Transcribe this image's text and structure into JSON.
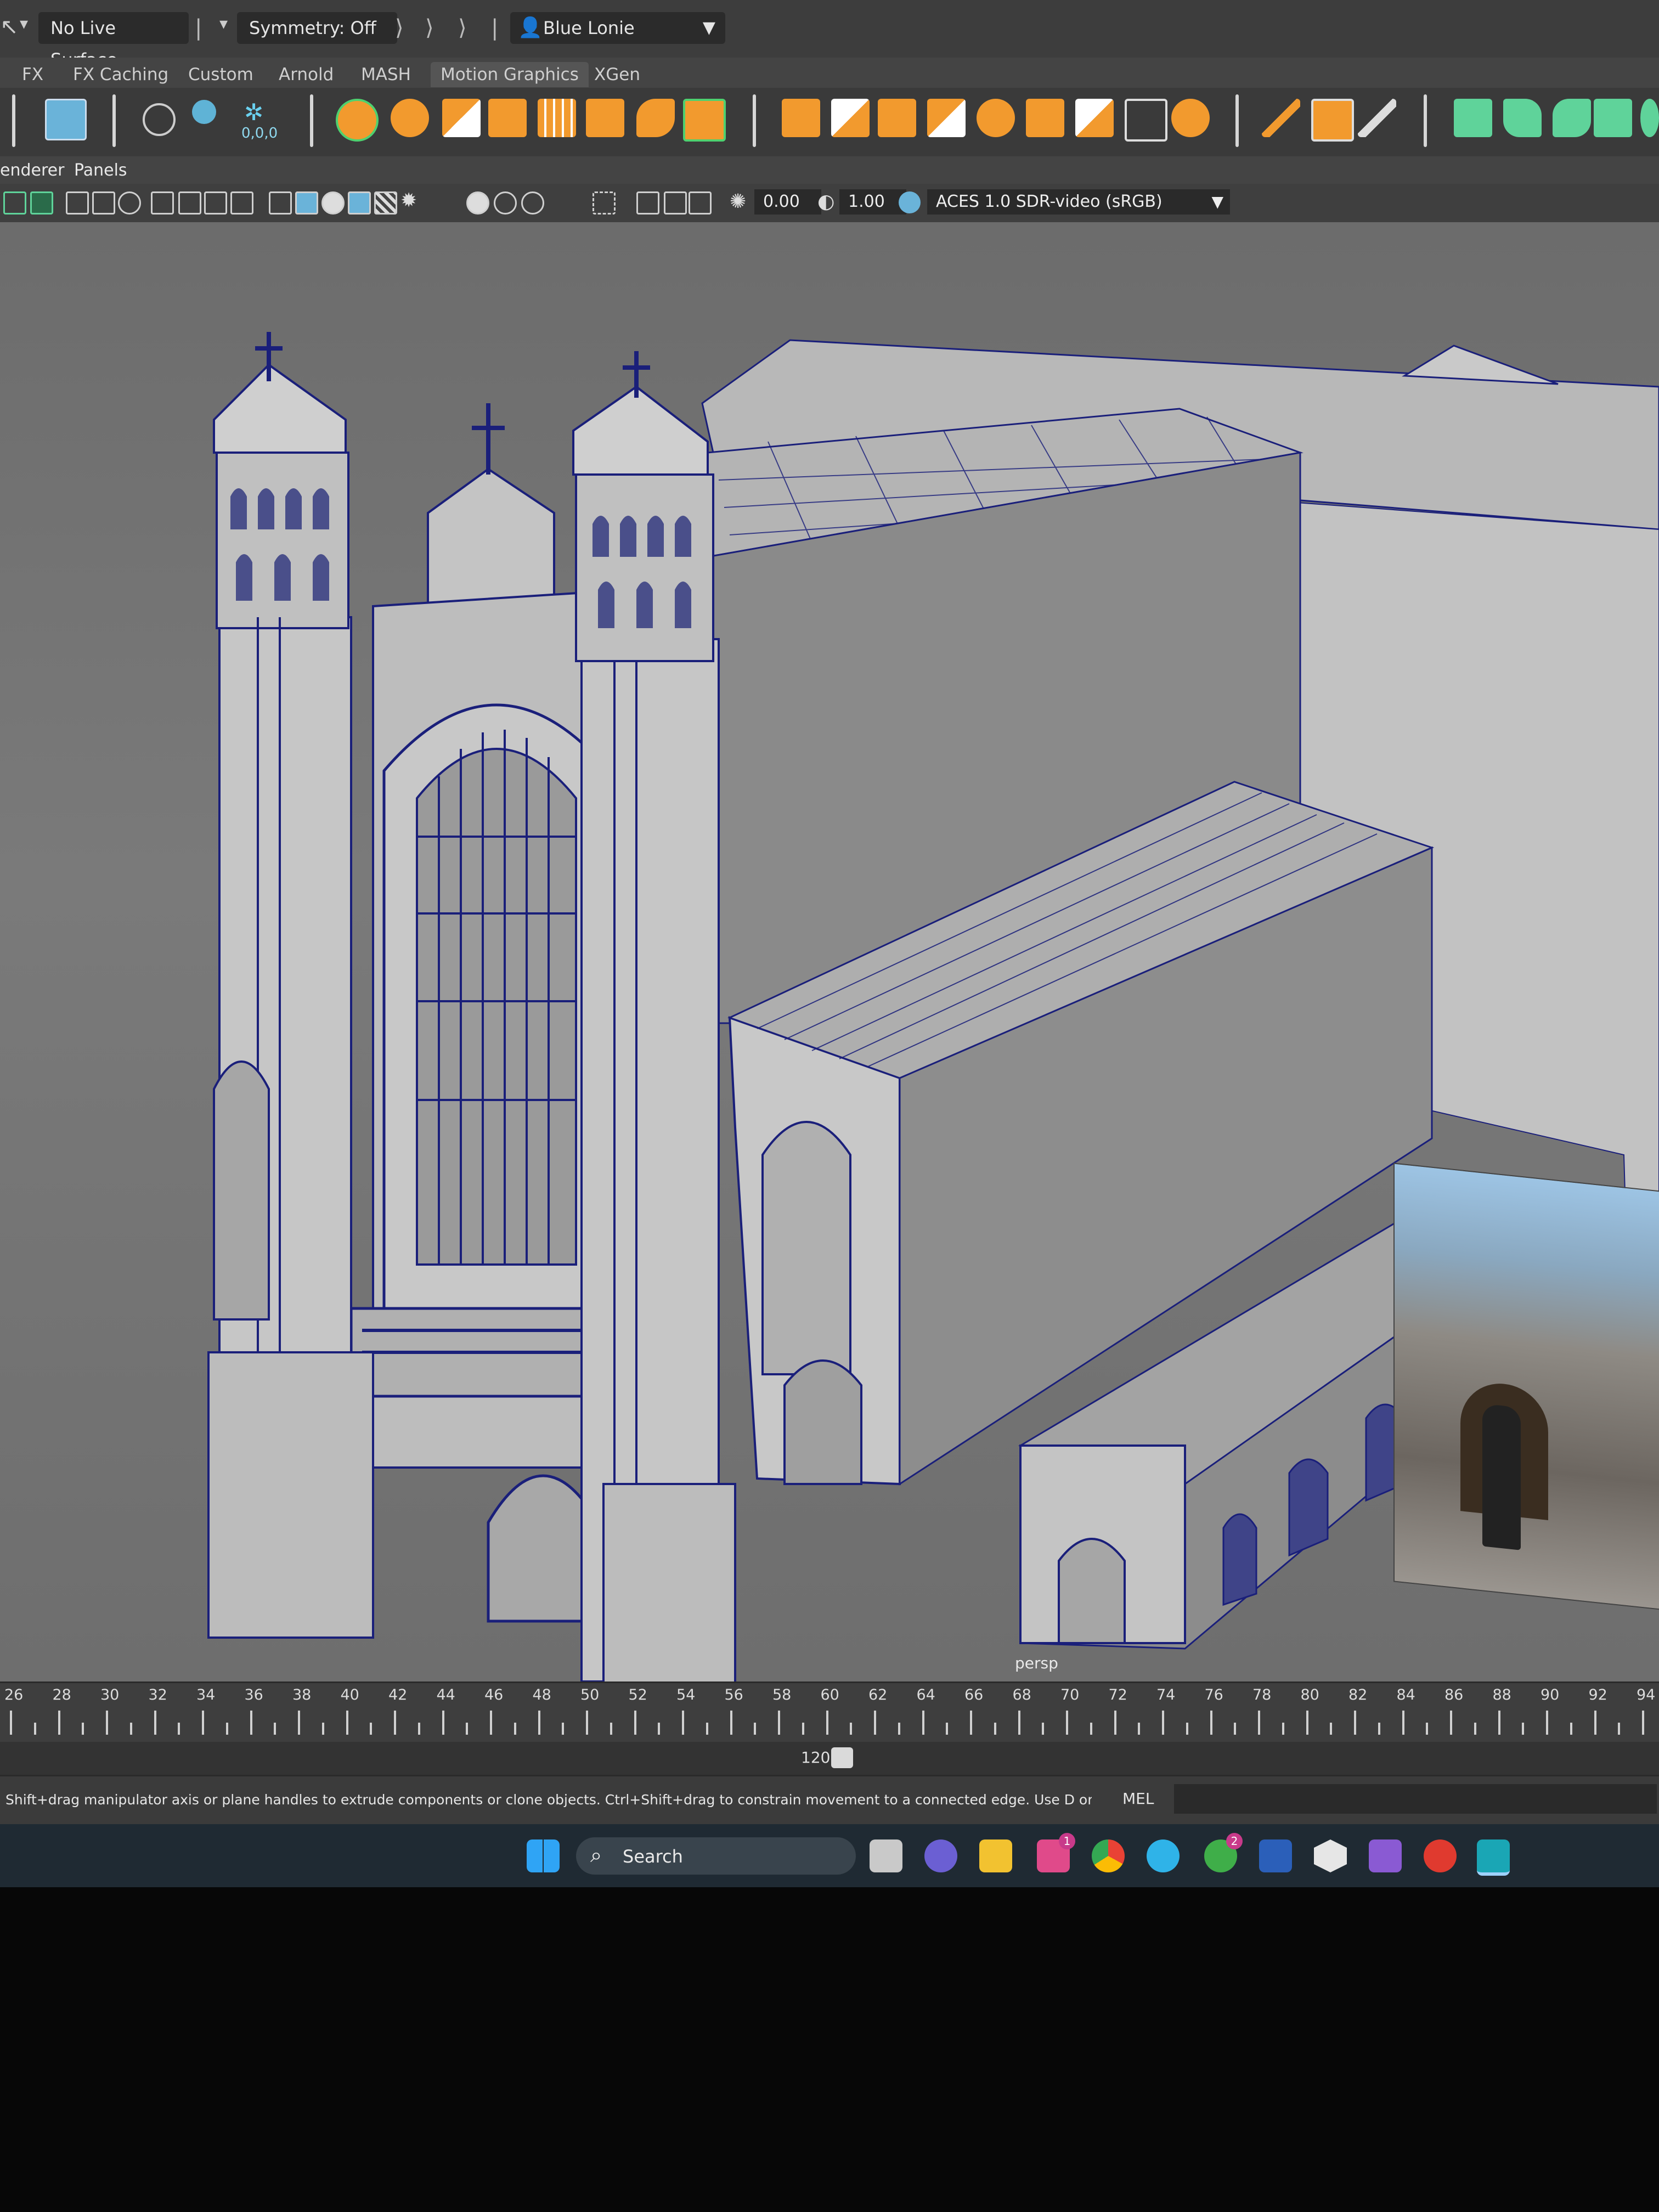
{
  "status_line": {
    "live_surface": "No Live Surface",
    "symmetry": "Symmetry: Off",
    "workspace": "Blue Lonie"
  },
  "shelf_tabs": [
    "FX",
    "FX Caching",
    "Custom",
    "Arnold",
    "MASH",
    "Motion Graphics",
    "XGen"
  ],
  "shelf_icons_text": {
    "coords": "0,0,0"
  },
  "panel_menu": {
    "renderer": "enderer",
    "panels": "Panels"
  },
  "panel_toolbar": {
    "exposure": "0.00",
    "gamma": "1.00",
    "color_space": "ACES 1.0 SDR-video (sRGB)"
  },
  "viewport": {
    "camera_label": "persp"
  },
  "time_slider": {
    "ticks": [
      "26",
      "28",
      "30",
      "32",
      "34",
      "36",
      "38",
      "40",
      "42",
      "44",
      "46",
      "48",
      "50",
      "52",
      "54",
      "56",
      "58",
      "60",
      "62",
      "64",
      "66",
      "68",
      "70",
      "72",
      "74",
      "76",
      "78",
      "80",
      "82",
      "84",
      "86",
      "88",
      "90",
      "92",
      "94"
    ],
    "range_end": "120"
  },
  "help_line": {
    "text": "Shift+drag manipulator axis or plane handles to extrude components or clone objects. Ctrl+Shift+drag to constrain movement to a connected edge. Use D or INSERT to change the pivot posit",
    "script_lang": "MEL"
  },
  "taskbar": {
    "search_label": "Search",
    "store_badge": "1",
    "xbox_badge": "2"
  },
  "colors": {
    "maya_accent": "#5fd39a",
    "shelf_orange": "#f29a2e",
    "wire_blue": "#1a1f7a",
    "model_grey": "#c9c9c9"
  }
}
